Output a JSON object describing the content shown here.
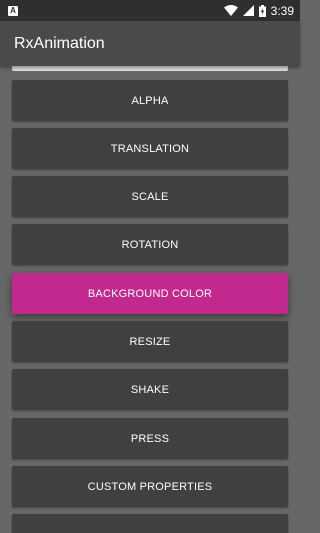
{
  "status_bar": {
    "notification_icon": "A",
    "time": "3:39",
    "icons": [
      "wifi-icon",
      "signal-icon",
      "battery-charging-icon"
    ]
  },
  "app_bar": {
    "title": "RxAnimation"
  },
  "buttons": [
    {
      "label": "ALPHA"
    },
    {
      "label": "TRANSLATION"
    },
    {
      "label": "SCALE"
    },
    {
      "label": "ROTATION"
    },
    {
      "label": "BACKGROUND COLOR",
      "active": true
    },
    {
      "label": "RESIZE"
    },
    {
      "label": "SHAKE"
    },
    {
      "label": "PRESS"
    },
    {
      "label": "CUSTOM PROPERTIES"
    },
    {
      "label": ""
    }
  ],
  "colors": {
    "background": "#676767",
    "button": "#404040",
    "button_active": "#c2298e",
    "app_bar": "#4a4a4a",
    "status_bar": "#2f2f2f"
  }
}
